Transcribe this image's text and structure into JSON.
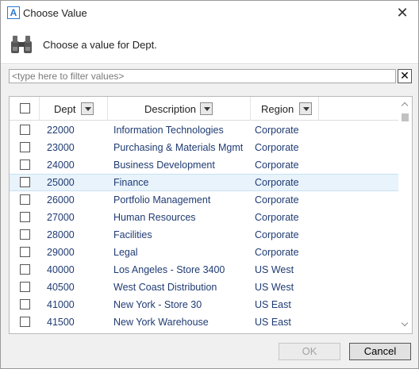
{
  "window": {
    "title": "Choose Value",
    "app_icon_letter": "A",
    "close_glyph": "✕"
  },
  "header": {
    "icon": "binoculars-icon",
    "prompt": "Choose a value for Dept."
  },
  "filter": {
    "placeholder": "<type here to filter values>",
    "value": "",
    "clear_glyph": "✕"
  },
  "grid": {
    "columns": [
      {
        "key": "dept",
        "label": "Dept"
      },
      {
        "key": "description",
        "label": "Description"
      },
      {
        "key": "region",
        "label": "Region"
      }
    ],
    "rows": [
      {
        "dept": "22000",
        "description": "Information Technologies",
        "region": "Corporate",
        "checked": false,
        "highlighted": false
      },
      {
        "dept": "23000",
        "description": "Purchasing & Materials Mgmt",
        "region": "Corporate",
        "checked": false,
        "highlighted": false
      },
      {
        "dept": "24000",
        "description": "Business Development",
        "region": "Corporate",
        "checked": false,
        "highlighted": false
      },
      {
        "dept": "25000",
        "description": "Finance",
        "region": "Corporate",
        "checked": false,
        "highlighted": true
      },
      {
        "dept": "26000",
        "description": "Portfolio Management",
        "region": "Corporate",
        "checked": false,
        "highlighted": false
      },
      {
        "dept": "27000",
        "description": "Human Resources",
        "region": "Corporate",
        "checked": false,
        "highlighted": false
      },
      {
        "dept": "28000",
        "description": "Facilities",
        "region": "Corporate",
        "checked": false,
        "highlighted": false
      },
      {
        "dept": "29000",
        "description": "Legal",
        "region": "Corporate",
        "checked": false,
        "highlighted": false
      },
      {
        "dept": "40000",
        "description": "Los Angeles - Store 3400",
        "region": "US West",
        "checked": false,
        "highlighted": false
      },
      {
        "dept": "40500",
        "description": "West Coast Distribution",
        "region": "US West",
        "checked": false,
        "highlighted": false
      },
      {
        "dept": "41000",
        "description": "New York - Store 30",
        "region": "US East",
        "checked": false,
        "highlighted": false
      },
      {
        "dept": "41500",
        "description": "New York Warehouse",
        "region": "US East",
        "checked": false,
        "highlighted": false
      }
    ]
  },
  "footer": {
    "ok_label": "OK",
    "ok_enabled": false,
    "cancel_label": "Cancel"
  },
  "colors": {
    "row_text": "#1f3b73",
    "highlight_row": "#e8f3fb",
    "body_bg": "#f0f0f0"
  }
}
